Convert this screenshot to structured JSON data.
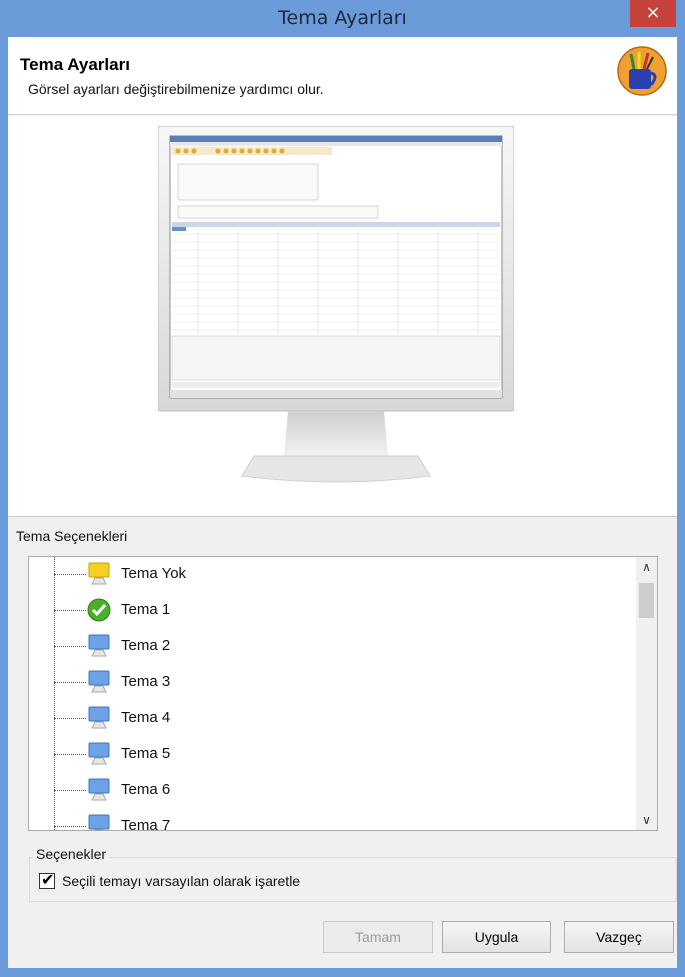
{
  "window": {
    "title": "Tema Ayarları",
    "close_label": "×"
  },
  "header": {
    "title": "Tema Ayarları",
    "subtitle": "Görsel ayarları değiştirebilmenize yardımcı olur."
  },
  "themes_section": {
    "label": "Tema Seçenekleri",
    "items": [
      {
        "label": "Tema Yok",
        "icon": "monitor-yellow-icon"
      },
      {
        "label": "Tema 1",
        "icon": "green-check-icon",
        "selected": true
      },
      {
        "label": "Tema 2",
        "icon": "monitor-blue-icon"
      },
      {
        "label": "Tema 3",
        "icon": "monitor-blue-icon"
      },
      {
        "label": "Tema 4",
        "icon": "monitor-blue-icon"
      },
      {
        "label": "Tema 5",
        "icon": "monitor-blue-icon"
      },
      {
        "label": "Tema 6",
        "icon": "monitor-blue-icon"
      },
      {
        "label": "Tema 7",
        "icon": "monitor-blue-icon"
      }
    ]
  },
  "options": {
    "legend": "Seçenekler",
    "default_checkbox_label": "Seçili temayı varsayılan olarak işaretle",
    "default_checked": true
  },
  "buttons": {
    "ok": "Tamam",
    "apply": "Uygula",
    "cancel": "Vazgeç"
  },
  "colors": {
    "titlebar": "#6b9bd8",
    "close": "#c7423a",
    "accent_green": "#4caf2c"
  }
}
